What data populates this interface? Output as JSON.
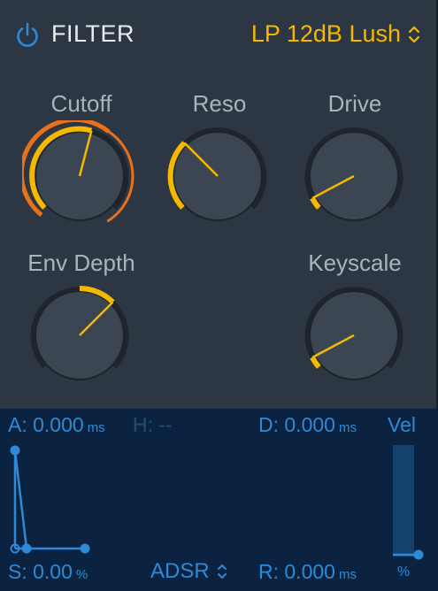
{
  "header": {
    "title": "FILTER",
    "preset": "LP 12dB Lush",
    "power_on": true
  },
  "knobs": {
    "cutoff": {
      "label": "Cutoff"
    },
    "reso": {
      "label": "Reso"
    },
    "drive": {
      "label": "Drive"
    },
    "env_depth": {
      "label": "Env Depth"
    },
    "keyscale": {
      "label": "Keyscale"
    }
  },
  "envelope": {
    "attack": {
      "prefix": "A:",
      "value": "0.000",
      "unit": "ms"
    },
    "hold": {
      "prefix": "H:",
      "value": "--"
    },
    "decay": {
      "prefix": "D:",
      "value": "0.000",
      "unit": "ms"
    },
    "sustain": {
      "prefix": "S:",
      "value": "0.00",
      "unit": "%"
    },
    "release": {
      "prefix": "R:",
      "value": "0.000",
      "unit": "ms"
    },
    "mode": "ADSR",
    "velocity": {
      "label": "Vel",
      "unit": "%",
      "level": 0.0
    }
  },
  "colors": {
    "accent_yellow": "#f5b800",
    "accent_orange": "#e8711a",
    "env_blue": "#2e8ad8",
    "background": "#2d3744",
    "env_background": "#0b2340"
  }
}
